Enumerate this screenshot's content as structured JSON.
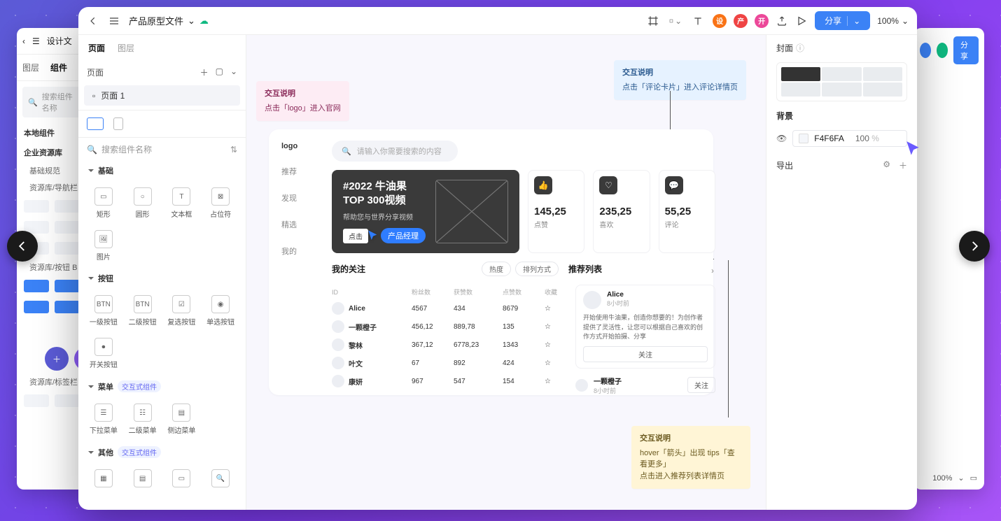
{
  "topbar": {
    "file_title": "产品原型文件",
    "badges": [
      "设",
      "产",
      "开"
    ],
    "share_label": "分享",
    "zoom": "100%"
  },
  "left_panel": {
    "tabs": [
      "页面",
      "图层"
    ],
    "pages_heading": "页面",
    "page1": "页面 1",
    "search_placeholder": "搜索组件名称",
    "section_basic": "基础",
    "tiles_basic": [
      "矩形",
      "圆形",
      "文本框",
      "占位符",
      "图片"
    ],
    "section_button": "按钮",
    "tiles_button": [
      "一级按钮",
      "二级按钮",
      "复选按钮",
      "单选按钮",
      "开关按钮"
    ],
    "section_menu": "菜单",
    "interactive_tag": "交互式组件",
    "tiles_menu": [
      "下拉菜单",
      "二级菜单",
      "侧边菜单"
    ],
    "section_other": "其他"
  },
  "canvas": {
    "note_pink_title": "交互说明",
    "note_pink_body": "点击「logo」进入官网",
    "note_blue_title": "交互说明",
    "note_blue_body": "点击「评论卡片」进入评论详情页",
    "note_yellow_title": "交互说明",
    "note_yellow_body1": "hover「箭头」出现 tips「查看更多」",
    "note_yellow_body2": "点击进入推荐列表详情页",
    "cursor_label": "产品经理",
    "mock": {
      "nav": [
        "logo",
        "推荐",
        "发现",
        "精选",
        "我的"
      ],
      "search_placeholder": "请输入你需要搜索的内容",
      "hero_title": "#2022 牛油果 TOP 300视频",
      "hero_sub": "帮助您与世界分享视频",
      "hero_btn": "点击",
      "stats": [
        {
          "val": "145,25",
          "lbl": "点赞"
        },
        {
          "val": "235,25",
          "lbl": "喜欢"
        },
        {
          "val": "55,25",
          "lbl": "评论"
        }
      ],
      "follow_heading": "我的关注",
      "chip1": "热度",
      "chip2": "排列方式",
      "reco_heading": "推荐列表",
      "table_head": [
        "ID",
        "粉丝数",
        "获赞数",
        "点赞数",
        "收藏"
      ],
      "table": [
        {
          "name": "Alice",
          "c1": "4567",
          "c2": "434",
          "c3": "8679"
        },
        {
          "name": "一颗橙子",
          "c1": "456,12",
          "c2": "889,78",
          "c3": "135"
        },
        {
          "name": "黎林",
          "c1": "367,12",
          "c2": "6778,23",
          "c3": "1343"
        },
        {
          "name": "叶文",
          "c1": "67",
          "c2": "892",
          "c3": "424"
        },
        {
          "name": "康妍",
          "c1": "967",
          "c2": "547",
          "c3": "154"
        }
      ],
      "reco1_name": "Alice",
      "reco1_time": "8小时前",
      "reco_desc": "开始使用牛油果，创造你想要的！为创作者提供了灵活性，让您可以根据自己喜欢的创作方式开始拍摄、分享",
      "follow_btn": "关注",
      "reco2_name": "一颗橙子",
      "reco2_time": "8小时前"
    }
  },
  "right_panel": {
    "cover_label": "封面",
    "bg_label": "背景",
    "color_hex": "F4F6FA",
    "opacity": "100",
    "opacity_unit": "%",
    "export_label": "导出"
  },
  "bg_left": {
    "title": "设计文",
    "tabs": [
      "图层",
      "组件"
    ],
    "search": "搜索组件名称",
    "g1": "本地组件",
    "g2": "企业资源库",
    "s1": "基础规范",
    "s2": "资源库/导航栏",
    "s3": "资源库/按钮 B",
    "s4": "资源库/标签栏"
  },
  "bg_right": {
    "share": "分享",
    "zoom": "100%"
  }
}
